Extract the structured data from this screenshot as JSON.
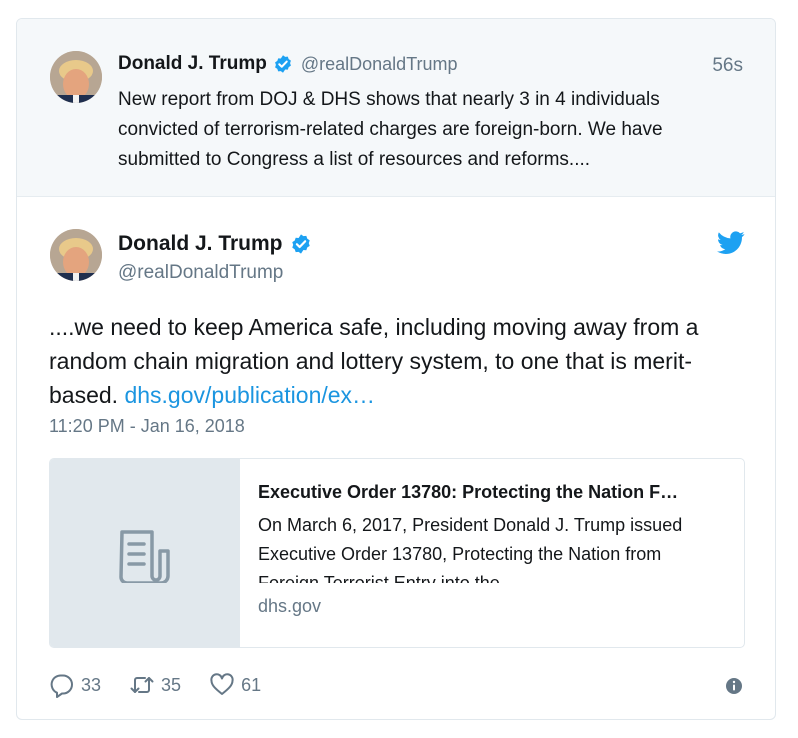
{
  "parent_tweet": {
    "author_name": "Donald J. Trump",
    "handle": "@realDonaldTrump",
    "time_ago": "56s",
    "text": "New report from DOJ & DHS shows that nearly 3 in 4 individuals convicted of terrorism-related charges are foreign-born. We have submitted to Congress a list of resources and reforms...."
  },
  "main_tweet": {
    "author_name": "Donald J. Trump",
    "handle": "@realDonaldTrump",
    "text": "....we need to keep America safe, including moving away from a random chain migration and lottery system, to one that is merit-based.",
    "link_text": "dhs.gov/publication/ex…",
    "timestamp": "11:20 PM - Jan 16, 2018",
    "link_card": {
      "title": "Executive Order 13780: Protecting the Nation F…",
      "description": "On March 6, 2017, President Donald J. Trump issued Executive Order 13780, Protecting the Nation from Foreign Terrorist Entry into the",
      "domain": "dhs.gov",
      "thumbnail_icon": "document-icon"
    },
    "actions": {
      "replies": "33",
      "retweets": "35",
      "likes": "61"
    }
  },
  "icons": {
    "verified": "verified-badge-icon",
    "brand": "twitter-bird-icon",
    "reply": "reply-icon",
    "retweet": "retweet-icon",
    "like": "heart-icon",
    "info": "info-icon"
  },
  "colors": {
    "accent": "#1da1f2",
    "link": "#1b95e0",
    "secondary_text": "#657786",
    "parent_background": "#f5f8fa"
  }
}
